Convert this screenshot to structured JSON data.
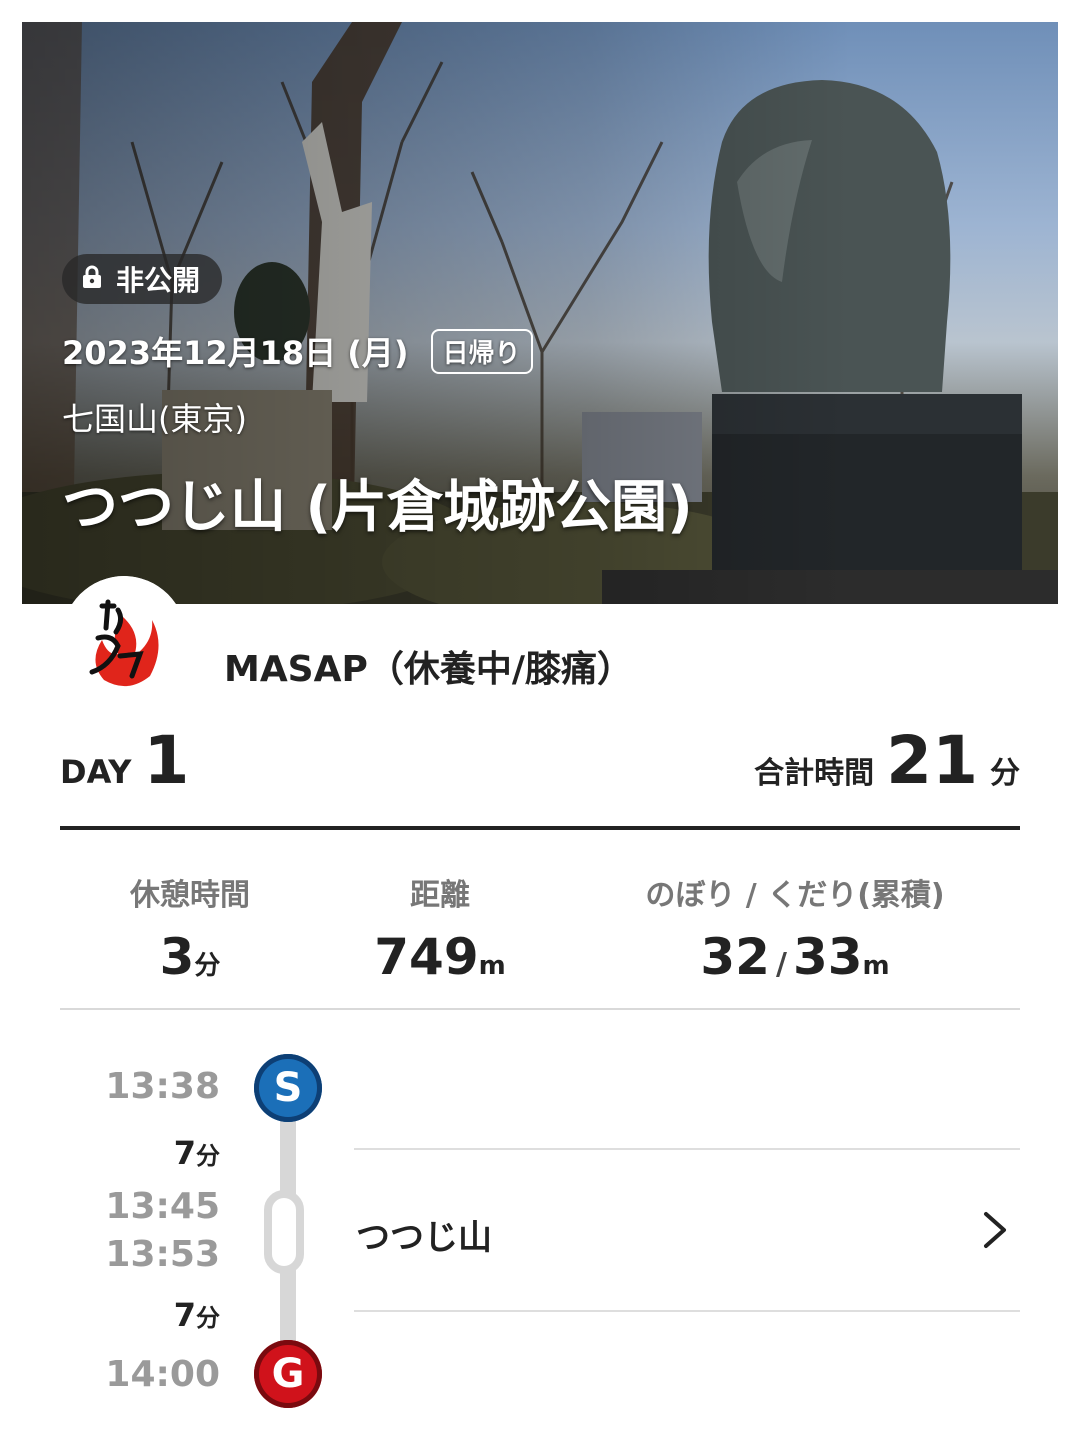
{
  "hero": {
    "visibility": "非公開",
    "date": "2023年12月18日 (月)",
    "trip_type": "日帰り",
    "mountain": "七国山(東京)",
    "title": "つつじ山 (片倉城跡公園)"
  },
  "user": {
    "name": "MASAP（休養中/膝痛）"
  },
  "day": {
    "label": "DAY",
    "number": "1"
  },
  "total_time": {
    "label": "合計時間",
    "value": "21",
    "unit": "分"
  },
  "stats": {
    "rest": {
      "label": "休憩時間",
      "value": "3",
      "unit": "分"
    },
    "distance": {
      "label": "距離",
      "value": "749",
      "unit": "m"
    },
    "elevation": {
      "label": "のぼり / くだり(累積)",
      "up": "32",
      "separator": "/",
      "down": "33",
      "unit": "m"
    }
  },
  "timeline": {
    "start_time": "13:38",
    "start_marker": "S",
    "leg1_minutes": "7",
    "leg1_unit": "分",
    "waypoint_arrive": "13:45",
    "waypoint_depart": "13:53",
    "waypoint_name": "つつじ山",
    "leg2_minutes": "7",
    "leg2_unit": "分",
    "goal_time": "14:00",
    "goal_marker": "G"
  },
  "colors": {
    "start": "#1b6fb8",
    "goal": "#d0121b",
    "track": "#d7d7d7"
  },
  "icons": [
    "lock-icon",
    "chevron-right-icon"
  ]
}
